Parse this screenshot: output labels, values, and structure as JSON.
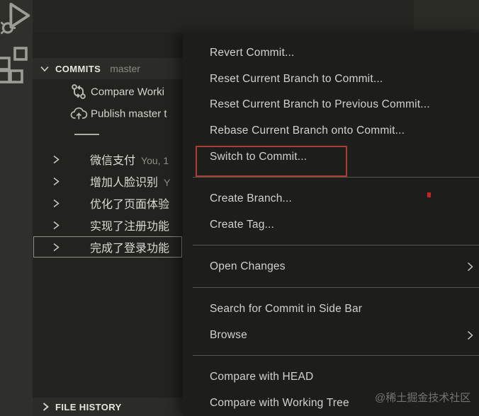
{
  "colors": {
    "annotation_red": "#ab3b35",
    "annotation_dot_red": "#c1251d",
    "menu_background": "#1d1d1b",
    "sidebar_background": "#22221f",
    "activity_bar_background": "#2f2f2b"
  },
  "activity_bar": {
    "icons": [
      {
        "name": "run-and-debug-icon"
      },
      {
        "name": "extensions-icon"
      }
    ]
  },
  "sidebar": {
    "commits": {
      "title": "COMMITS",
      "branch": "master",
      "actions": [
        {
          "icon": "git-compare-icon",
          "label": "Compare Worki"
        },
        {
          "icon": "cloud-upload-icon",
          "label": "Publish master t"
        }
      ],
      "rows": [
        {
          "label": "微信支付",
          "meta": "You, 1"
        },
        {
          "label": "增加人脸识别",
          "meta": "Y"
        },
        {
          "label": "优化了页面体验",
          "meta": ""
        },
        {
          "label": "实现了注册功能",
          "meta": ""
        },
        {
          "label": "完成了登录功能",
          "meta": ""
        }
      ]
    },
    "file_history": {
      "title": "FILE HISTORY"
    }
  },
  "context_menu": {
    "groups": [
      {
        "items": [
          {
            "label": "Revert Commit..."
          },
          {
            "label": "Reset Current Branch to Commit..."
          },
          {
            "label": "Reset Current Branch to Previous Commit..."
          },
          {
            "label": "Rebase Current Branch onto Commit..."
          },
          {
            "label": "Switch to Commit..."
          }
        ]
      },
      {
        "items": [
          {
            "label": "Create Branch..."
          },
          {
            "label": "Create Tag..."
          }
        ]
      },
      {
        "items": [
          {
            "label": "Open Changes"
          }
        ]
      },
      {
        "items": [
          {
            "label": "Search for Commit in Side Bar"
          },
          {
            "label": "Browse"
          }
        ]
      },
      {
        "items": [
          {
            "label": "Compare with HEAD"
          },
          {
            "label": "Compare with Working Tree"
          }
        ]
      }
    ]
  },
  "watermark": "@稀土掘金技术社区"
}
